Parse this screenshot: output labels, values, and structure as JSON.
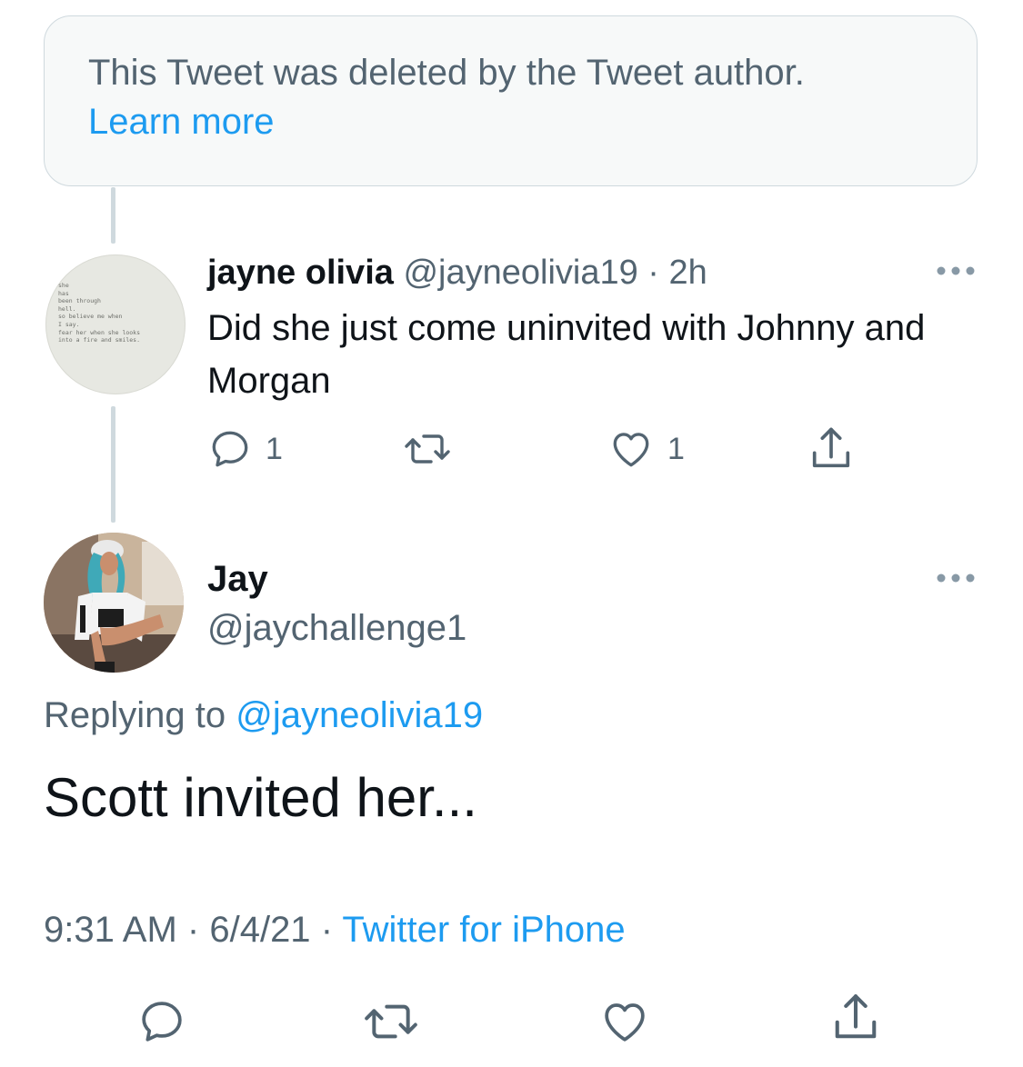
{
  "deleted_notice": {
    "text": "This Tweet was deleted by the Tweet author.",
    "link": "Learn more"
  },
  "reply": {
    "name": "jayne olivia",
    "handle": "@jayneolivia19",
    "separator": "·",
    "time": "2h",
    "text": "Did she just come uninvited with Johnny and Morgan",
    "reply_count": "1",
    "like_count": "1",
    "avatar_icon": "quote-text-avatar",
    "avatar_text": "she\nhas\nbeen through\nhell.\nso believe me when\nI say.\nfear her when she looks\ninto a fire and smiles."
  },
  "tweet": {
    "name": "Jay",
    "handle": "@jaychallenge1",
    "replying_prefix": "Replying to",
    "replying_to": "@jayneolivia19",
    "text": "Scott invited her...",
    "time": "9:31 AM",
    "dot": "·",
    "date": "6/4/21",
    "source": "Twitter for iPhone",
    "avatar_icon": "profile-photo-avatar"
  },
  "colors": {
    "link": "#1d9bf0",
    "muted": "#536471",
    "text": "#0f1419",
    "border": "#cfd9de"
  }
}
